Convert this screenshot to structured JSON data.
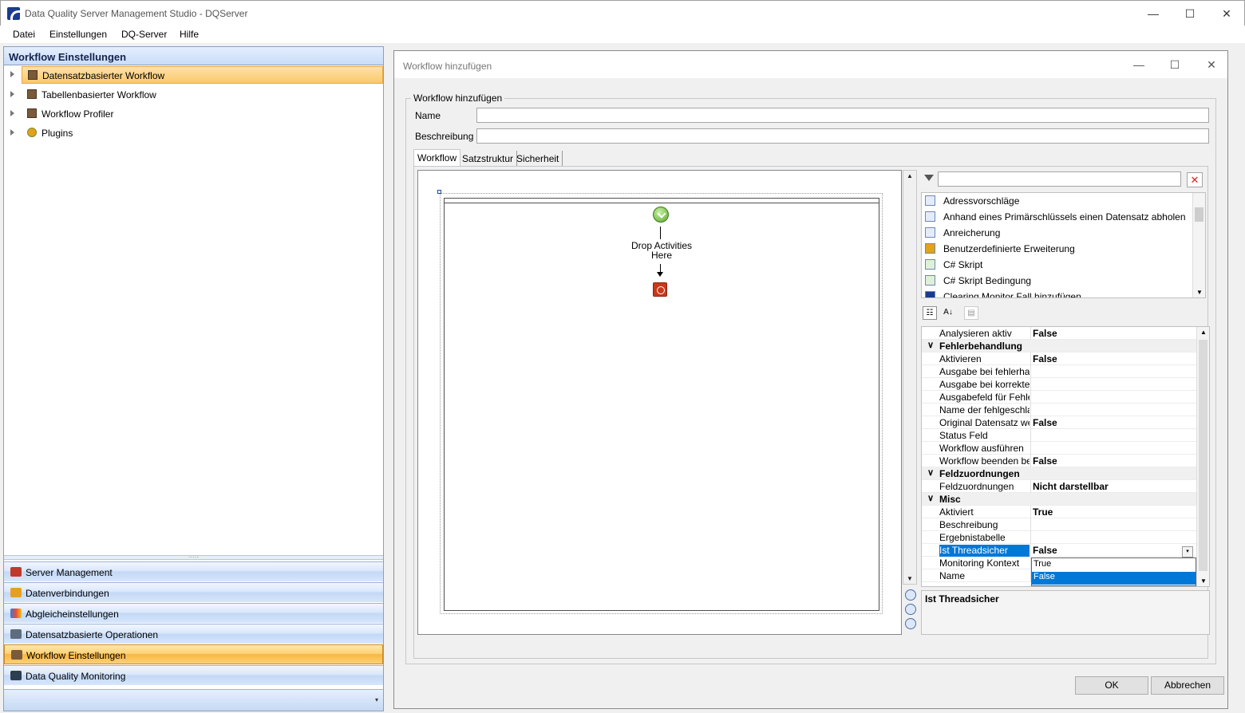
{
  "window": {
    "title": "Data Quality Server Management Studio - DQServer",
    "min": "—",
    "max": "☐",
    "close": "✕"
  },
  "menu": [
    "Datei",
    "Einstellungen",
    "DQ-Server",
    "Hilfe"
  ],
  "left": {
    "header": "Workflow Einstellungen",
    "tree": [
      {
        "label": "Datensatzbasierter Workflow"
      },
      {
        "label": "Tabellenbasierter Workflow"
      },
      {
        "label": "Workflow Profiler"
      },
      {
        "label": "Plugins"
      }
    ],
    "splitter": "·····",
    "nav": [
      {
        "label": "Server Management",
        "icon": "wrench-icon",
        "color": "#c0392b"
      },
      {
        "label": "Datenverbindungen",
        "icon": "database-icon",
        "color": "#e6a020"
      },
      {
        "label": "Abgleicheinstellungen",
        "icon": "chart-icon",
        "color": "#3a7bd5"
      },
      {
        "label": "Datensatzbasierte Operationen",
        "icon": "flow-icon",
        "color": "#5d6d7e"
      },
      {
        "label": "Workflow Einstellungen",
        "icon": "workflow-icon",
        "color": "#7a5a3a"
      },
      {
        "label": "Data Quality Monitoring",
        "icon": "monitor-icon",
        "color": "#2c3e50"
      }
    ],
    "foot_chevron": "▾"
  },
  "dialog": {
    "title": "Workflow hinzufügen",
    "min": "—",
    "max": "☐",
    "close": "✕",
    "group_title": "Workflow hinzufügen",
    "name_label": "Name",
    "name_value": "",
    "desc_label": "Beschreibung",
    "desc_value": "",
    "tabs": [
      "Workflow",
      "Satzstruktur",
      "Sicherheit"
    ],
    "designer": {
      "drop_text_1": "Drop Activities",
      "drop_text_2": "Here"
    },
    "scroll_up": "▲",
    "scroll_down": "▼",
    "toolbox": {
      "filter_value": "",
      "clear": "✕",
      "items": [
        "Adressvorschläge",
        "Anhand eines Primärschlüssels einen Datensatz abholen",
        "Anreicherung",
        "Benutzerdefinierte Erweiterung",
        "C# Skript",
        "C# Skript Bedingung",
        "Clearing Monitor Fall hinzufügen"
      ],
      "scroll_down": "▼"
    },
    "props": {
      "toolbar": {
        "categorized": "☷",
        "sort": "A↓",
        "pages": "▤"
      },
      "rows": [
        {
          "type": "prop",
          "name": "Analysieren aktiv",
          "value": "False"
        },
        {
          "type": "cat",
          "name": "Fehlerbehandlung",
          "toggle": "∨"
        },
        {
          "type": "prop",
          "name": "Aktivieren",
          "value": "False"
        },
        {
          "type": "prop",
          "name": "Ausgabe bei fehlerhafte",
          "value": ""
        },
        {
          "type": "prop",
          "name": "Ausgabe bei korrekter",
          "value": ""
        },
        {
          "type": "prop",
          "name": "Ausgabefeld für Fehler",
          "value": ""
        },
        {
          "type": "prop",
          "name": "Name der fehlgeschlag",
          "value": ""
        },
        {
          "type": "prop",
          "name": "Original Datensatz wei",
          "value": "False"
        },
        {
          "type": "prop",
          "name": "Status Feld",
          "value": ""
        },
        {
          "type": "prop",
          "name": "Workflow ausführen",
          "value": ""
        },
        {
          "type": "prop",
          "name": "Workflow beenden bei",
          "value": "False"
        },
        {
          "type": "cat",
          "name": "Feldzuordnungen",
          "toggle": "∨"
        },
        {
          "type": "prop",
          "name": "Feldzuordnungen",
          "value": "Nicht darstellbar"
        },
        {
          "type": "cat",
          "name": "Misc",
          "toggle": "∨"
        },
        {
          "type": "prop",
          "name": "Aktiviert",
          "value": "True"
        },
        {
          "type": "prop",
          "name": "Beschreibung",
          "value": ""
        },
        {
          "type": "prop",
          "name": "Ergebnistabelle",
          "value": ""
        },
        {
          "type": "prop",
          "name": "Ist Threadsicher",
          "value": "False",
          "selected": true
        },
        {
          "type": "prop",
          "name": "Monitoring Kontext",
          "value": ""
        },
        {
          "type": "prop",
          "name": "Name",
          "value": ""
        }
      ],
      "dropdown": [
        "True",
        "False"
      ],
      "dropdown_selected": "False",
      "combo_arrow": "▾",
      "help_title": "Ist Threadsicher"
    },
    "ok": "OK",
    "cancel": "Abbrechen"
  }
}
